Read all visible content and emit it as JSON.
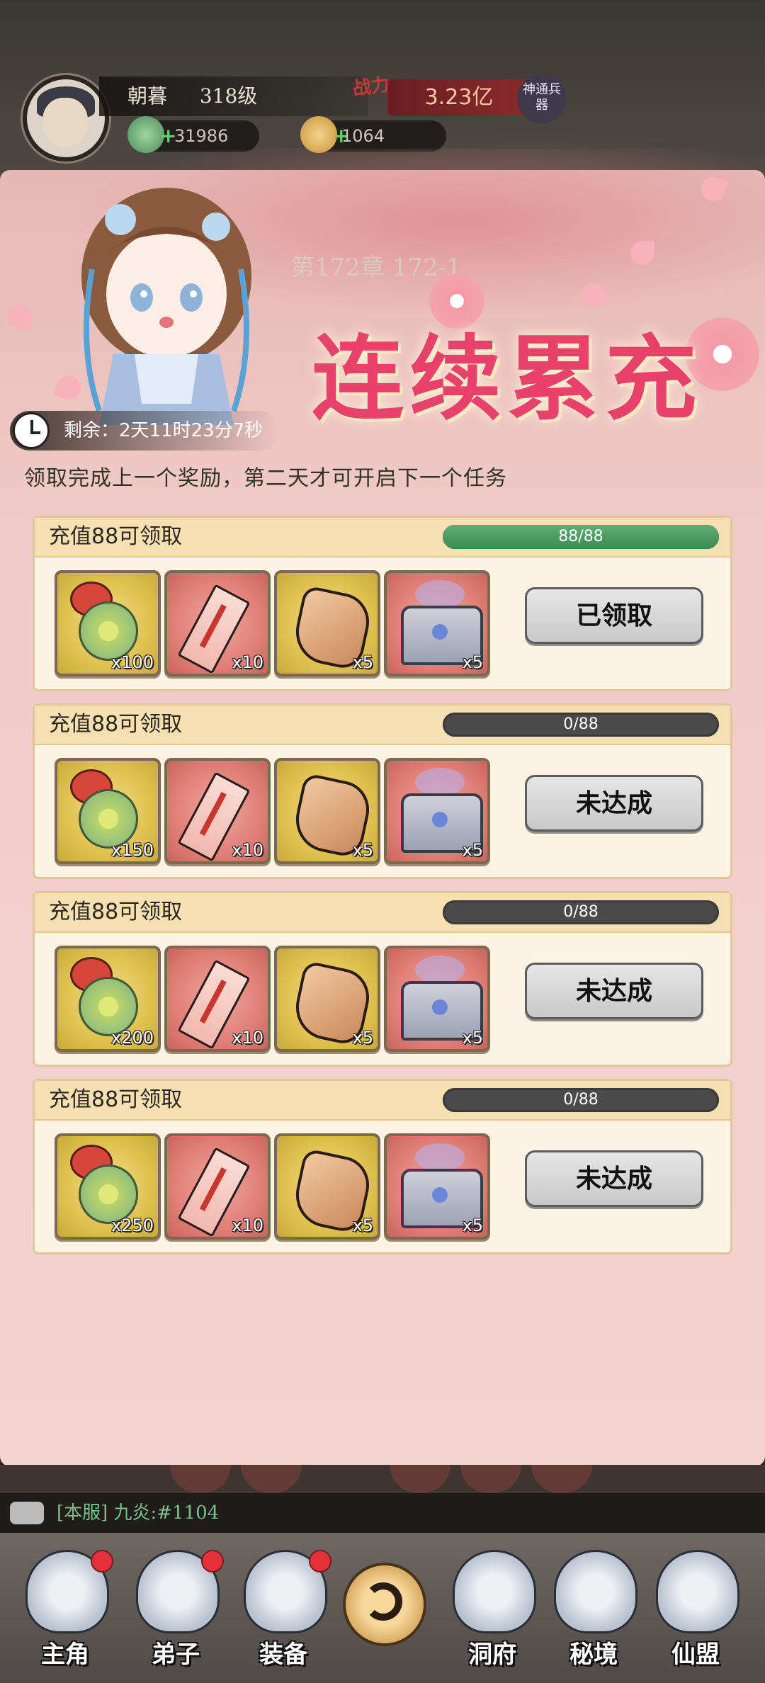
{
  "player": {
    "name": "朝暮",
    "level": "318级",
    "power_label": "战力",
    "power_value": "3.23亿",
    "rank_badge": "神通兵器",
    "jade": "31986",
    "gold": "1064"
  },
  "chapter": "第172章 172-1",
  "event": {
    "title": "连续累充",
    "timer": "剩余：2天11时23分7秒",
    "rule": "领取完成上一个奖励，第二天才可开启下一个任务"
  },
  "tasks": [
    {
      "title": "充值88可领取",
      "progress_text": "88/88",
      "progress_ratio": 1.0,
      "button": "已领取",
      "rewards": [
        {
          "icon": "coin-bag-icon",
          "count": "x100"
        },
        {
          "icon": "talisman-icon",
          "count": "x10"
        },
        {
          "icon": "spirit-stone-icon",
          "count": "x5"
        },
        {
          "icon": "treasure-chest-icon",
          "count": "x5"
        }
      ]
    },
    {
      "title": "充值88可领取",
      "progress_text": "0/88",
      "progress_ratio": 0,
      "button": "未达成",
      "rewards": [
        {
          "icon": "coin-bag-icon",
          "count": "x150"
        },
        {
          "icon": "talisman-icon",
          "count": "x10"
        },
        {
          "icon": "spirit-stone-icon",
          "count": "x5"
        },
        {
          "icon": "treasure-chest-icon",
          "count": "x5"
        }
      ]
    },
    {
      "title": "充值88可领取",
      "progress_text": "0/88",
      "progress_ratio": 0,
      "button": "未达成",
      "rewards": [
        {
          "icon": "coin-bag-icon",
          "count": "x200"
        },
        {
          "icon": "talisman-icon",
          "count": "x10"
        },
        {
          "icon": "spirit-stone-icon",
          "count": "x5"
        },
        {
          "icon": "treasure-chest-icon",
          "count": "x5"
        }
      ]
    },
    {
      "title": "充值88可领取",
      "progress_text": "0/88",
      "progress_ratio": 0,
      "button": "未达成",
      "rewards": [
        {
          "icon": "coin-bag-icon",
          "count": "x250"
        },
        {
          "icon": "talisman-icon",
          "count": "x10"
        },
        {
          "icon": "spirit-stone-icon",
          "count": "x5"
        },
        {
          "icon": "treasure-chest-icon",
          "count": "x5"
        }
      ]
    }
  ],
  "chat": {
    "text": "[本服] 九炎:#1104"
  },
  "nav": {
    "items": [
      {
        "label": "主角",
        "icon": "protagonist-icon",
        "badge": true
      },
      {
        "label": "弟子",
        "icon": "disciple-icon",
        "badge": true
      },
      {
        "label": "装备",
        "icon": "equipment-icon",
        "badge": true
      },
      {
        "label": "",
        "icon": "back-arrow-icon",
        "badge": false
      },
      {
        "label": "洞府",
        "icon": "cave-dwelling-icon",
        "badge": false
      },
      {
        "label": "秘境",
        "icon": "secret-realm-icon",
        "badge": false
      },
      {
        "label": "仙盟",
        "icon": "immortal-alliance-icon",
        "badge": false
      }
    ]
  },
  "colors": {
    "progress_fill": "#4c9a63",
    "progress_empty": "#4a4a4a",
    "title_pink": "#e9426a",
    "badge_red": "#e5303a"
  }
}
